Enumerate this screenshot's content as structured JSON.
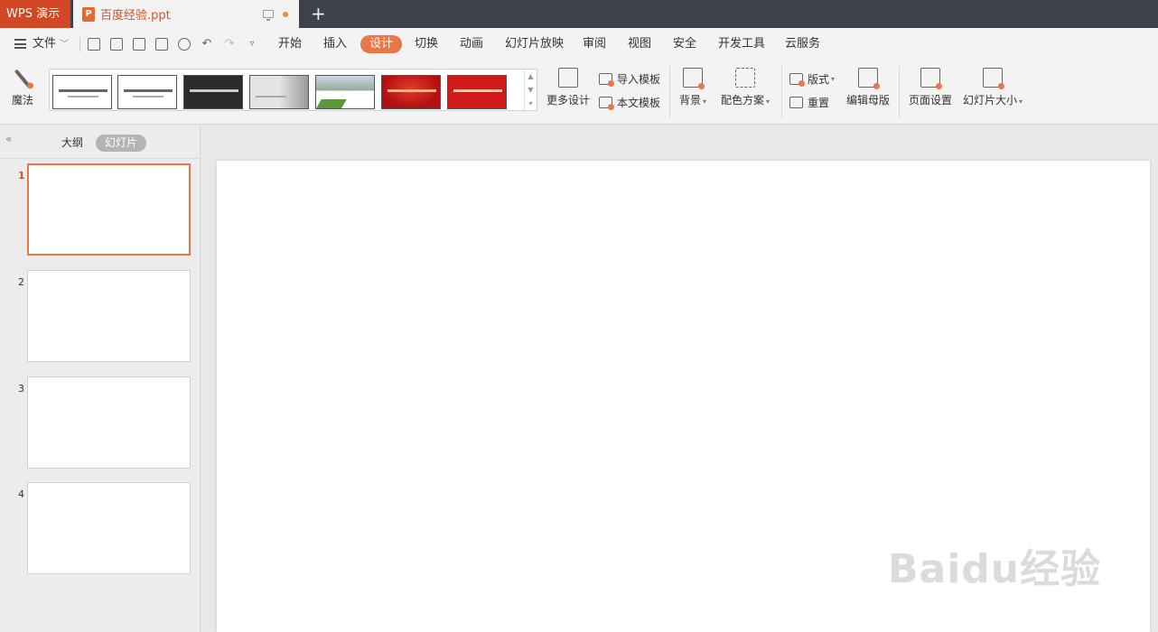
{
  "titlebar": {
    "app_name": "WPS 演示",
    "doc_name": "百度经验.ppt",
    "doc_icon_letter": "P",
    "new_tab": "+"
  },
  "menubar": {
    "file_label": "文件",
    "tabs": [
      "开始",
      "插入",
      "设计",
      "切换",
      "动画",
      "幻灯片放映",
      "审阅",
      "视图",
      "安全",
      "开发工具",
      "云服务"
    ],
    "active_tab": "设计"
  },
  "ribbon": {
    "magic": "魔法",
    "more_design": "更多设计",
    "import_template": "导入模板",
    "this_template": "本文模板",
    "background": "背景",
    "color_scheme": "配色方案",
    "layout": "版式",
    "reset": "重置",
    "edit_master": "编辑母版",
    "page_setup": "页面设置",
    "slide_size": "幻灯片大小",
    "accent_color": "#e8784a"
  },
  "left_pane": {
    "outline_tab": "大纲",
    "slides_tab": "幻灯片",
    "slide_numbers": [
      "1",
      "2",
      "3",
      "4"
    ],
    "active_slide": "1"
  },
  "watermark": "Baidu经验"
}
